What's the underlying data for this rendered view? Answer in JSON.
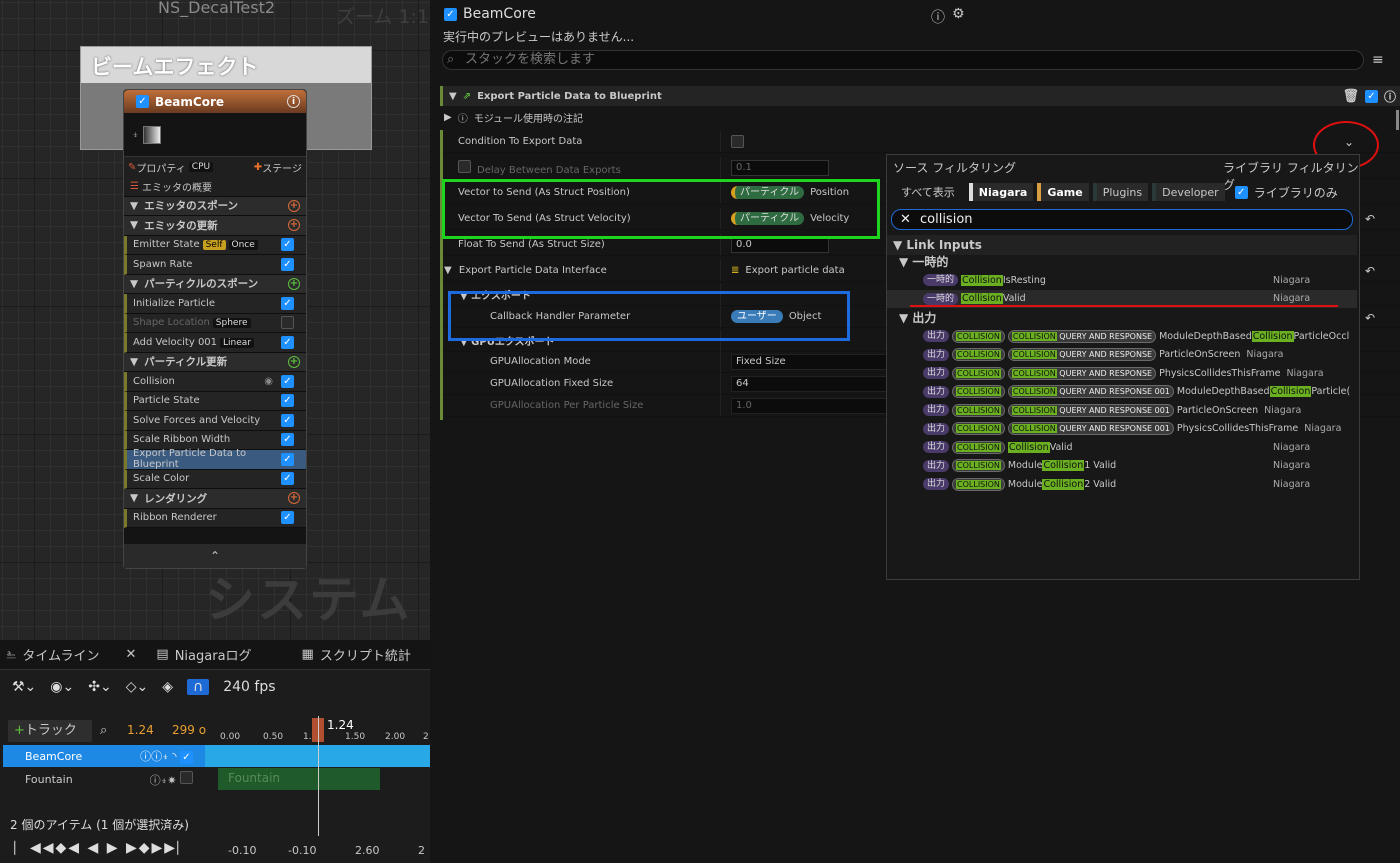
{
  "graph": {
    "title": "NS_DecalTest2",
    "zoom": "ズーム 1:1",
    "watermark": "システム",
    "comment_title": "ビームエフェクト"
  },
  "node": {
    "title": "BeamCore",
    "prop_label": "プロパティ",
    "cpu_label": "CPU",
    "stage_label": "ステージ",
    "rows": [
      {
        "type": "head",
        "label": "エミッタの概要"
      },
      {
        "type": "sec",
        "label": "エミッタのスポーン",
        "plus": "o"
      },
      {
        "type": "sec",
        "label": "エミッタの更新",
        "plus": "o"
      },
      {
        "type": "item",
        "label": "Emitter State",
        "pills": [
          "Self",
          "Once"
        ],
        "checked": true
      },
      {
        "type": "item",
        "label": "Spawn Rate",
        "checked": true
      },
      {
        "type": "sec",
        "label": "パーティクルのスポーン",
        "plus": "g"
      },
      {
        "type": "item",
        "label": "Initialize Particle",
        "checked": true
      },
      {
        "type": "item",
        "label": "Shape Location",
        "pills": [
          "Sphere"
        ],
        "checked": false,
        "dim": true
      },
      {
        "type": "item",
        "label": "Add Velocity 001",
        "pills": [
          "Linear"
        ],
        "checked": true
      },
      {
        "type": "sec",
        "label": "パーティクル更新",
        "plus": "g"
      },
      {
        "type": "item",
        "label": "Collision",
        "checked": true,
        "eye": true
      },
      {
        "type": "item",
        "label": "Particle State",
        "checked": true
      },
      {
        "type": "item",
        "label": "Solve Forces and Velocity",
        "checked": true
      },
      {
        "type": "item",
        "label": "Scale Ribbon Width",
        "checked": true
      },
      {
        "type": "item",
        "label": "Export Particle Data to Blueprint",
        "checked": true,
        "selected": true
      },
      {
        "type": "item",
        "label": "Scale Color",
        "checked": true
      },
      {
        "type": "sec",
        "label": "レンダリング",
        "plus": "o"
      },
      {
        "type": "item",
        "label": "Ribbon Renderer",
        "checked": true
      }
    ]
  },
  "timeline": {
    "tabs": [
      "タイムライン",
      "Niagaraログ",
      "スクリプト統計"
    ],
    "fps": "240 fps",
    "add_track": "トラック",
    "time": "1.24",
    "frames": "299 o",
    "ruler": [
      "0.00",
      "0.50",
      "1.00",
      "1.50",
      "2.00",
      "2"
    ],
    "playhead": "1.24",
    "tracks": [
      "BeamCore",
      "Fountain"
    ],
    "status": "2 個のアイテム (1 個が選択済み)",
    "bottom": [
      "-0.10",
      "-0.10",
      "2.60",
      "2"
    ]
  },
  "details": {
    "title": "BeamCore",
    "no_preview": "実行中のプレビューはありません...",
    "search_placeholder": "スタックを検索します",
    "module": "Export Particle Data to Blueprint",
    "note": "モジュール使用時の注記",
    "props": [
      {
        "label": "Condition To Export Data",
        "kind": "check"
      },
      {
        "label": "Delay Between Data Exports",
        "kind": "val",
        "value": "0.1",
        "dim": true
      },
      {
        "label": "Vector to Send (As Struct Position)",
        "kind": "tag",
        "tag": "パーティクル",
        "value": "Position"
      },
      {
        "label": "Vector To Send (As Struct Velocity)",
        "kind": "tag",
        "tag": "パーティクル",
        "value": "Velocity"
      },
      {
        "label": "Float To Send (As Struct Size)",
        "kind": "val",
        "value": "0.0"
      },
      {
        "label": "Export Particle Data Interface",
        "kind": "di",
        "value": "Export particle data"
      },
      {
        "label": "エクスポート",
        "kind": "sub"
      },
      {
        "label": "Callback Handler Parameter",
        "kind": "user",
        "tag": "ユーザー",
        "value": "Object"
      },
      {
        "label": "GPUエクスポート",
        "kind": "sub"
      },
      {
        "label": "GPUAllocation Mode",
        "kind": "val",
        "value": "Fixed Size"
      },
      {
        "label": "GPUAllocation Fixed Size",
        "kind": "val",
        "value": "64"
      },
      {
        "label": "GPUAllocation Per Particle Size",
        "kind": "val",
        "value": "1.0",
        "dim": true
      }
    ]
  },
  "popup": {
    "source_filter": "ソース フィルタリング",
    "library_filter": "ライブラリ フィルタリング",
    "show_all": "すべて表示",
    "chips": [
      "Niagara",
      "Game",
      "Plugins",
      "Developer"
    ],
    "library_only": "ライブラリのみ",
    "search": "collision",
    "link_inputs": "Link Inputs",
    "temp": "一時的",
    "output": "出力",
    "temp_items": [
      {
        "badge": "一時的",
        "hl": "Collision",
        "rest": "IsResting",
        "src": "Niagara"
      },
      {
        "badge": "一時的",
        "hl": "Collision",
        "rest": "Valid",
        "src": "Niagara"
      }
    ],
    "out_items": [
      {
        "b2": [
          "COLLISION",
          "COLLISION QUERY AND RESPONSE"
        ],
        "text": "ModuleDepthBased",
        "hl": "Collision",
        "rest": "ParticleOccl",
        "src": ""
      },
      {
        "b2": [
          "COLLISION",
          "COLLISION QUERY AND RESPONSE"
        ],
        "text": "ParticleOnScreen",
        "hl": "",
        "rest": "",
        "src": "Niagara"
      },
      {
        "b2": [
          "COLLISION",
          "COLLISION QUERY AND RESPONSE"
        ],
        "text": "PhysicsCollidesThisFrame",
        "hl": "",
        "rest": "",
        "src": "Niagara"
      },
      {
        "b2": [
          "COLLISION",
          "COLLISION QUERY AND RESPONSE 001"
        ],
        "text": "ModuleDepthBased",
        "hl": "Collision",
        "rest": "Particle(",
        "src": ""
      },
      {
        "b2": [
          "COLLISION",
          "COLLISION QUERY AND RESPONSE 001"
        ],
        "text": "ParticleOnScreen",
        "hl": "",
        "rest": "",
        "src": "Niagara"
      },
      {
        "b2": [
          "COLLISION",
          "COLLISION QUERY AND RESPONSE 001"
        ],
        "text": "PhysicsCollidesThisFrame",
        "hl": "",
        "rest": "",
        "src": "Niagara"
      },
      {
        "b2": [
          "COLLISION"
        ],
        "text": "",
        "hl": "Collision",
        "rest": "Valid",
        "src": "Niagara"
      },
      {
        "b2": [
          "COLLISION"
        ],
        "text": "Module",
        "hl": "Collision",
        "rest": " 1 Valid",
        "src": "Niagara"
      },
      {
        "b2": [
          "COLLISION"
        ],
        "text": "Module",
        "hl": "Collision",
        "rest": " 2 Valid",
        "src": "Niagara"
      }
    ]
  }
}
